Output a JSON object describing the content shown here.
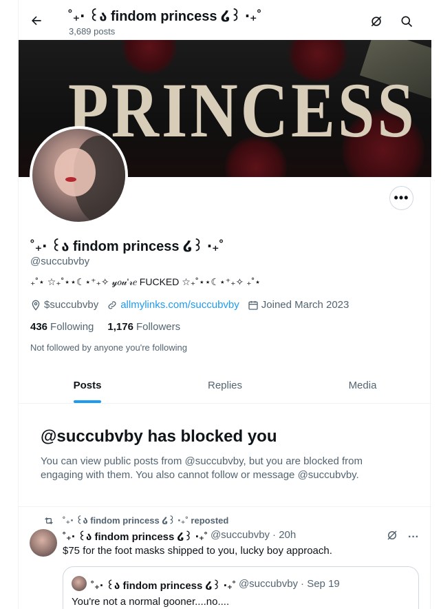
{
  "header": {
    "title": "˚₊‧ ꒰ა findom princess ໒꒱ ‧₊˚",
    "posts_count": "3,689 posts"
  },
  "banner": {
    "text": "PRINCESS"
  },
  "profile": {
    "display_name": "˚₊‧ ꒰ა findom princess ໒꒱ ‧₊˚",
    "handle": "@succubvby",
    "bio": "₊˚⋆ ☆₊˚⋆⋆☾⋆⁺₊✧ 𝓎𝑜𝓊'𝓇𝑒 FUCKED ☆₊˚⋆⋆☾⋆⁺₊✧ ₊˚⋆",
    "location": "$succubvby",
    "website": "allmylinks.com/succubvby",
    "joined": "Joined March 2023",
    "following_count": "436",
    "following_label": "Following",
    "followers_count": "1,176",
    "followers_label": "Followers",
    "not_followed_text": "Not followed by anyone you're following",
    "more_label": "•••"
  },
  "tabs": [
    {
      "label": "Posts",
      "active": true
    },
    {
      "label": "Replies",
      "active": false
    },
    {
      "label": "Media",
      "active": false
    }
  ],
  "blocked": {
    "title": "@succubvby has blocked you",
    "text": "You can view public posts from @succubvby, but you are blocked from engaging with them. You also cannot follow or message @succubvby."
  },
  "tweet": {
    "repost_label": "˚₊‧ ꒰ა findom princess ໒꒱ ‧₊˚ reposted",
    "author_name": "˚₊‧ ꒰ა findom princess ໒꒱ ‧₊˚",
    "author_handle": "@succubvby",
    "time": "· 20h",
    "text": "$75 for the foot masks shipped to you, lucky boy approach.",
    "more_label": "···",
    "quote": {
      "author_name": "˚₊‧ ꒰ა findom princess ໒꒱ ‧₊˚",
      "author_handle": "@succubvby",
      "time": "· Sep 19",
      "text": "You're not a normal gooner....no...."
    }
  },
  "colors": {
    "accent": "#1d9bf0",
    "muted_text": "#536471",
    "border": "#eff3f4"
  }
}
